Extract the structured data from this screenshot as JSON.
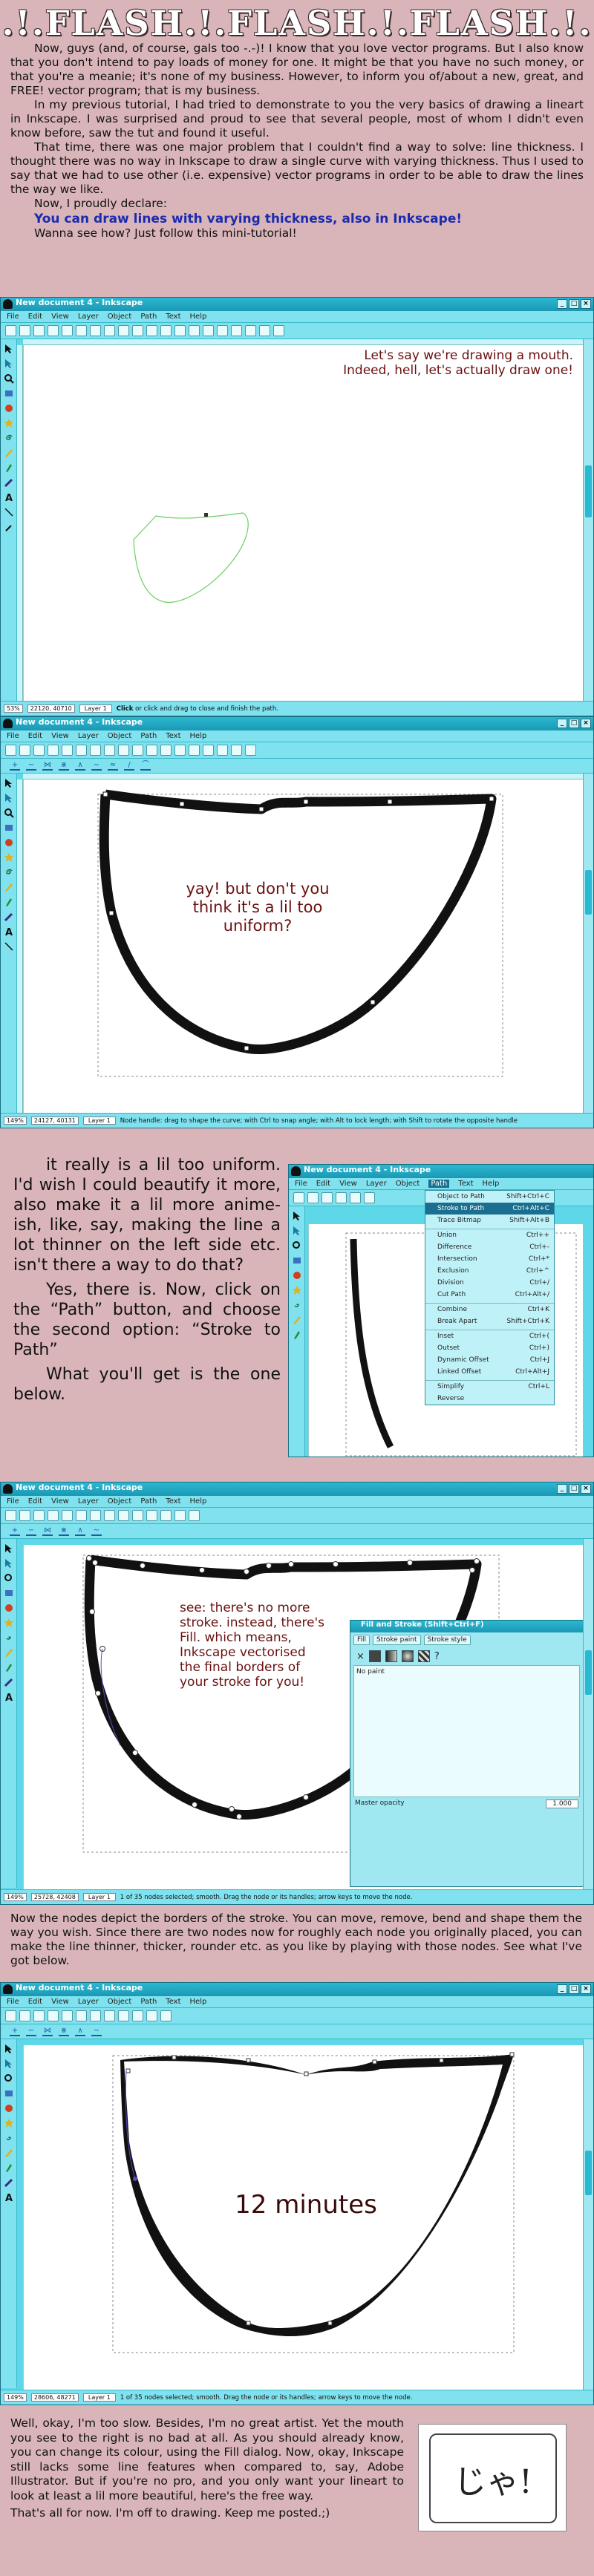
{
  "title": ".!.FLASH.!.FLASH.!.FLASH.!.",
  "intro": {
    "p1": "Now, guys (and, of course, gals too -.-)! I know that you love vector programs. But I also know that you don't intend to pay loads of money for one. It might be that you have no such money, or that you're a meanie; it's none of my business. However, to inform you of/about a new, great, and FREE! vector program; that is my business.",
    "p2": "In my previous tutorial, I had tried to demonstrate to you the very basics of drawing a lineart in Inkscape. I was surprised and proud to see that several people, most of whom I didn't even know before, saw the tut and found it useful.",
    "p3": "That time, there was one major problem that I couldn't find a way to solve: line thickness. I thought there was no way in Inkscape to draw a single curve with varying thickness. Thus I used to say that we had to use other (i.e. expensive) vector programs in order to be able to draw the lines the way we like.",
    "p4": "Now, I proudly declare:",
    "declare": "You can draw lines with varying thickness, also in Inkscape!",
    "wanna": "Wanna see how? Just follow this mini-tutorial!"
  },
  "window": {
    "title": "New document 4 - Inkscape",
    "menu": [
      "File",
      "Edit",
      "View",
      "Layer",
      "Object",
      "Path",
      "Text",
      "Help"
    ],
    "layer": "Layer 1"
  },
  "shot1": {
    "caption": "Let's say we're drawing a mouth. Indeed, hell, let's actually draw one!",
    "zoom": "53%",
    "coords": "22120, 40710",
    "status_bold1": "Click",
    "status_text": " or click and drag to close and finish the path."
  },
  "shot2": {
    "caption": "yay! but don't you think it's a lil too uniform?",
    "zoom": "149%",
    "coords": "24127, 40131",
    "status_text": "Node handle: drag to shape the curve; with Ctrl to snap angle; with Alt to lock length; with Shift to rotate the opposite handle"
  },
  "mid": {
    "p1": "it really is a lil too uniform. I'd wish I could beautify it more, also make it a lil more anime-ish, like, say, making the line a lot thinner on the left side etc. isn't there a way to do that?",
    "p2": "Yes, there is. Now, click on the “Path” button, and choose the second option: “Stroke to Path”",
    "p3": "What you'll get is the one below."
  },
  "shot3": {
    "title": "New document 4 - Inkscape",
    "menu": [
      "File",
      "Edit",
      "View",
      "Layer",
      "Object",
      "Path",
      "Text",
      "Help"
    ],
    "items": [
      {
        "label": "Object to Path",
        "key": "Shift+Ctrl+C"
      },
      {
        "label": "Stroke to Path",
        "key": "Ctrl+Alt+C"
      },
      {
        "label": "Trace Bitmap",
        "key": "Shift+Alt+B"
      },
      {
        "label": "Union",
        "key": "Ctrl++"
      },
      {
        "label": "Difference",
        "key": "Ctrl+-"
      },
      {
        "label": "Intersection",
        "key": "Ctrl+*"
      },
      {
        "label": "Exclusion",
        "key": "Ctrl+^"
      },
      {
        "label": "Division",
        "key": "Ctrl+/"
      },
      {
        "label": "Cut Path",
        "key": "Ctrl+Alt+/"
      },
      {
        "label": "Combine",
        "key": "Ctrl+K"
      },
      {
        "label": "Break Apart",
        "key": "Shift+Ctrl+K"
      },
      {
        "label": "Inset",
        "key": "Ctrl+("
      },
      {
        "label": "Outset",
        "key": "Ctrl+)"
      },
      {
        "label": "Dynamic Offset",
        "key": "Ctrl+J"
      },
      {
        "label": "Linked Offset",
        "key": "Ctrl+Alt+J"
      },
      {
        "label": "Simplify",
        "key": "Ctrl+L"
      },
      {
        "label": "Reverse",
        "key": ""
      }
    ]
  },
  "shot4": {
    "caption": "see: there's no more stroke. instead, there's Fill. which means, Inkscape vectorised the final borders of your stroke for you!",
    "zoom": "149%",
    "coords": "25728, 42408",
    "status_text": "1 of 35 nodes selected; smooth. Drag the node or its handles; arrow keys to move the node.",
    "dialog_title": "Fill and Stroke (Shift+Ctrl+F)",
    "tabs": [
      "Fill",
      "Stroke paint",
      "Stroke style"
    ],
    "no_paint": "No paint",
    "master": "Master opacity",
    "opacity": "1.000"
  },
  "note": "Now the nodes depict the borders of the stroke. You can move, remove, bend and shape them the way you wish. Since there are two nodes now for roughly each node you originally placed, you can make the line thinner, thicker, rounder etc. as you like by playing with those nodes. See what I've got below.",
  "shot5": {
    "caption": "12 minutes",
    "zoom": "149%",
    "coords": "28606, 48271",
    "status_text": "1 of 35 nodes selected; smooth. Drag the node or its handles; arrow keys to move the node."
  },
  "final": {
    "p1": "Well, okay, I'm too slow. Besides, I'm no great artist. Yet the mouth you see to the right is no bad at all. As you should already know, you can change its colour, using the Fill dialog. Now, okay, Inkscape still lacks some line features when compared to, say, Adobe Illustrator. But if you're no pro, and you only want your lineart to look at least a lil more beautiful, here's the free way.",
    "p2": "That's all for now. I'm off to drawing. Keep me posted.;)",
    "stamp": "じゃ!"
  }
}
